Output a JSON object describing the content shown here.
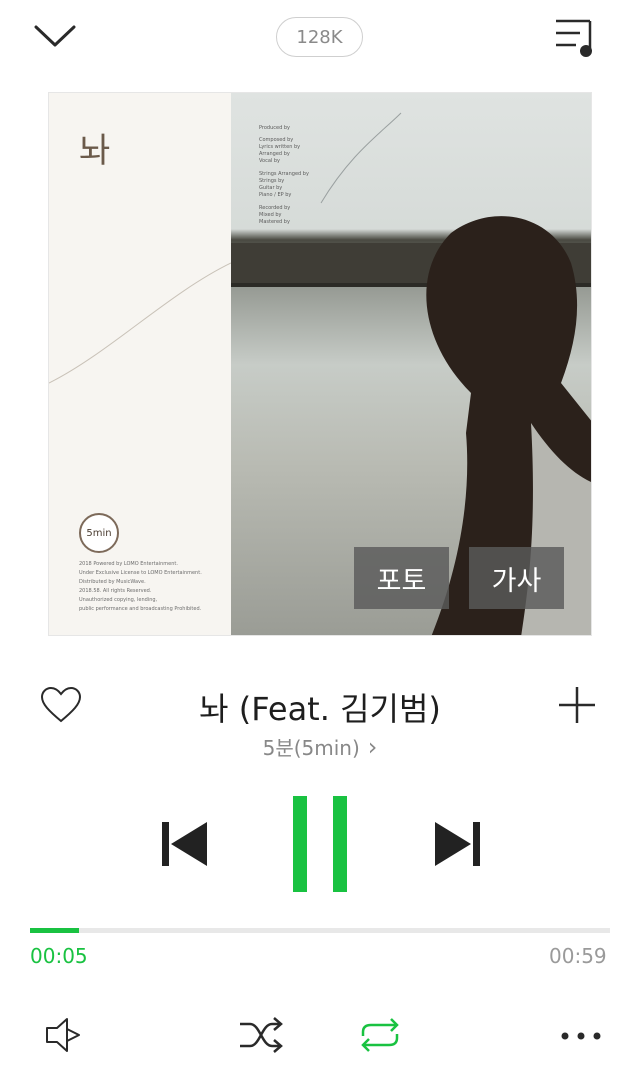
{
  "header": {
    "collapse_icon": "chevron-down-icon",
    "quality_label": "128K",
    "playlist_icon": "playlist-icon"
  },
  "album": {
    "title_script": "놔",
    "credits": [
      "Produced by",
      "Composed by",
      "Lyrics written by",
      "Arranged by",
      "Vocal by",
      "Strings Arranged by",
      "Strings by",
      "Guitar by",
      "Piano / EP by",
      "Recorded by",
      "Mixed by",
      "Mastered by"
    ],
    "logo_text": "5min",
    "legal": [
      "2018 Powered by LOMO Entertainment.",
      "Under Exclusive License to LOMO Entertainment.",
      "Distributed by MusicWave.",
      "2018.58. All rights Reserved.",
      "Unauthorized copying, lending,",
      "public performance and broadcasting Prohibited."
    ]
  },
  "overlay": {
    "photo_label": "포토",
    "lyrics_label": "가사"
  },
  "song": {
    "title": "놔 (Feat. 김기범)",
    "artist": "5분(5min)",
    "artist_chevron": "›"
  },
  "progress": {
    "elapsed": "00:05",
    "duration": "00:59",
    "fraction": 0.085
  },
  "colors": {
    "accent": "#19c241",
    "icon": "#2a2a2a",
    "muted": "#9a9a9a"
  },
  "icons": {
    "like": "heart-outline-icon",
    "add": "plus-icon",
    "prev": "skip-previous-icon",
    "pause": "pause-icon",
    "next": "skip-next-icon",
    "output": "audio-output-icon",
    "shuffle": "shuffle-icon",
    "repeat": "repeat-icon",
    "more": "more-horizontal-icon"
  }
}
